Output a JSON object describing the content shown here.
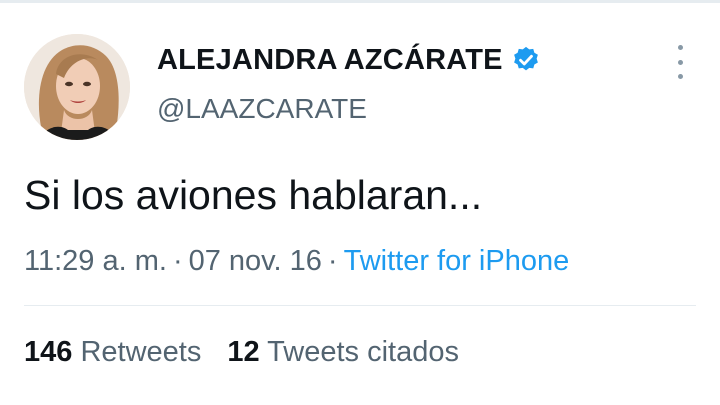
{
  "author": {
    "name": "ALEJANDRA AZCÁRATE",
    "handle": "@LAAZCARATE",
    "verified": true,
    "avatar_icon": "profile-photo"
  },
  "tweet": {
    "text": "Si los aviones hablaran...",
    "time": "11:29 a. m.",
    "date": "07 nov. 16",
    "separator": "·",
    "source": "Twitter for iPhone"
  },
  "stats": {
    "retweets_count": "146",
    "retweets_label": "Retweets",
    "quotes_count": "12",
    "quotes_label": "Tweets citados"
  },
  "colors": {
    "verified_badge": "#1d9bf0",
    "link": "#1d9bf0",
    "secondary_text": "#536471",
    "primary_text": "#0f1419"
  },
  "icons": {
    "more": "more-vertical-icon",
    "verified": "verified-badge-icon"
  }
}
